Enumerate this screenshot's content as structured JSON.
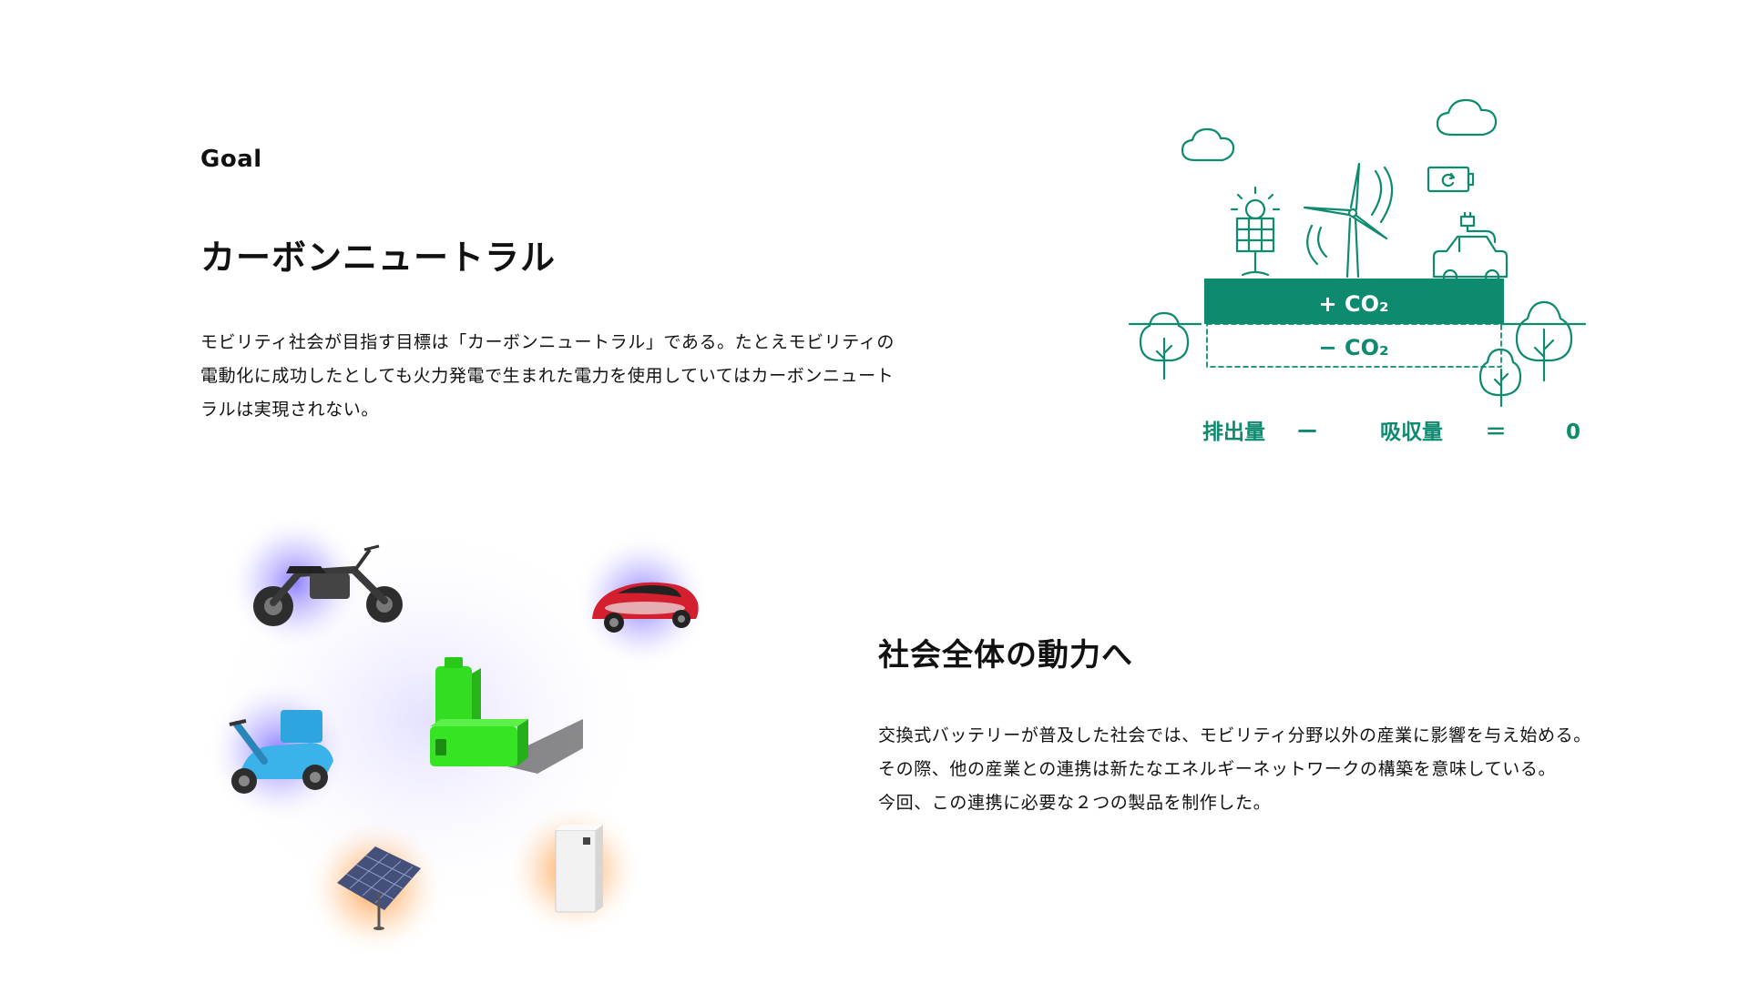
{
  "section1": {
    "label": "Goal",
    "title": "カーボンニュートラル",
    "body_lines": [
      "モビリティ社会が目指す目標は「カーボンニュートラル」である。たとえモビリティの",
      "電動化に成功したとしても火力発電で生まれた電力を使用していてはカーボンニュート",
      "ラルは実現されない。"
    ]
  },
  "diagram": {
    "plus_label": "+ CO₂",
    "minus_label": "− CO₂",
    "equation": {
      "term1": "排出量",
      "op1": "ー",
      "term2": "吸収量",
      "op2": "＝",
      "result": "0"
    },
    "icons": [
      "cloud-icon",
      "solar-panel-icon",
      "wind-turbine-icon",
      "battery-icon",
      "electric-car-icon",
      "tree-icon"
    ],
    "color": "#0e8a6f"
  },
  "section2": {
    "title": "社会全体の動力へ",
    "body_lines": [
      "交換式バッテリーが普及した社会では、モビリティ分野以外の産業に影響を与え始める。",
      "その際、他の産業との連携は新たなエネルギーネットワークの構築を意味している。",
      "今回、この連携に必要な２つの製品を制作した。"
    ]
  },
  "illustration": {
    "items": [
      "motorcycle",
      "electric-car",
      "scooter",
      "battery-pack",
      "solar-panel",
      "home-battery-unit"
    ],
    "glow_colors": {
      "mobility": "#8c7cff",
      "energy": "#ff9a3c",
      "battery": "#2fdc2f"
    }
  }
}
